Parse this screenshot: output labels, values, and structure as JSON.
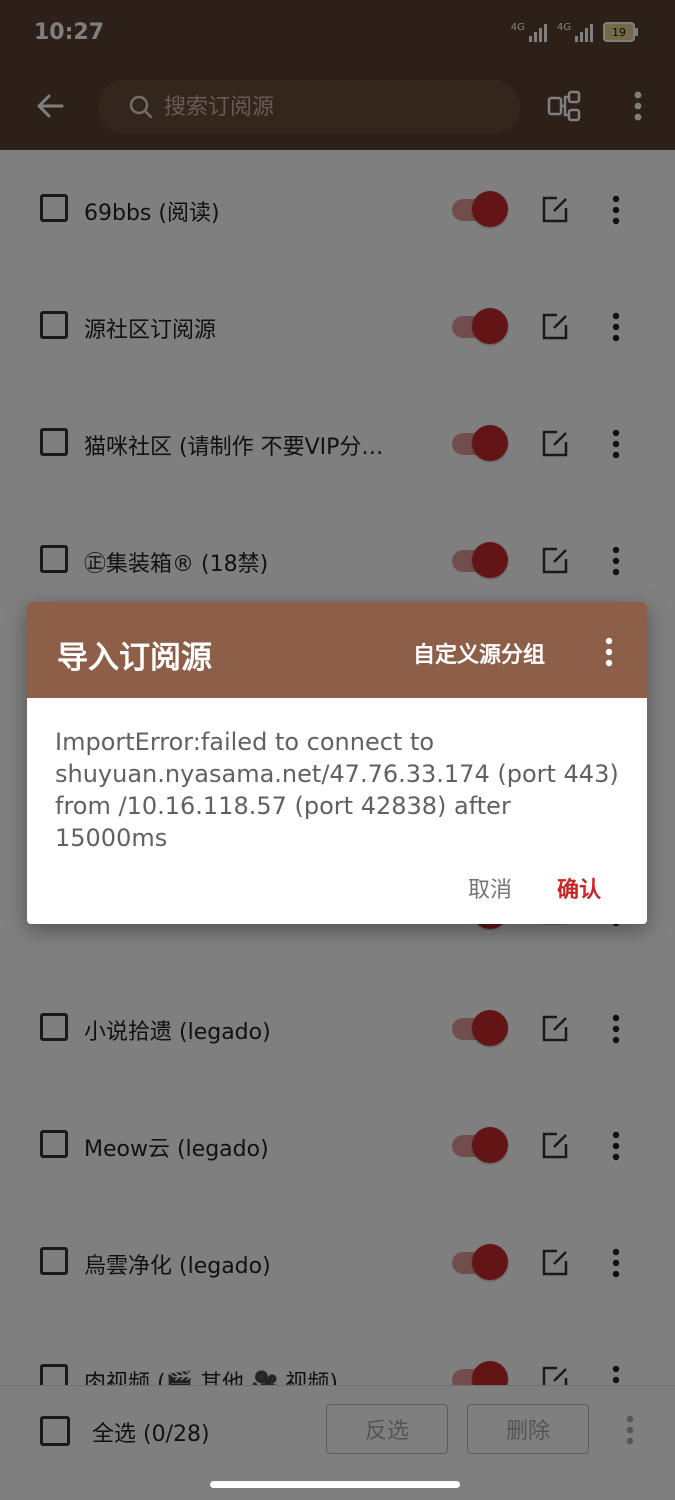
{
  "status_bar": {
    "time": "10:27",
    "signal1_label": "4G",
    "signal2_label": "4G",
    "battery": "19"
  },
  "app_bar": {
    "search_placeholder": "搜索订阅源",
    "back_icon": "arrow-left-icon",
    "group_icon": "group-icon",
    "more_icon": "more-vert-icon"
  },
  "list": {
    "items": [
      {
        "name": "69bbs (阅读)",
        "enabled": true
      },
      {
        "name": "源社区订阅源",
        "enabled": true
      },
      {
        "name": "猫咪社区 (请制作 不要VIP分…",
        "enabled": true
      },
      {
        "name": "㊣集装箱® (18禁)",
        "enabled": true
      },
      {
        "name": "",
        "enabled": true
      },
      {
        "name": "",
        "enabled": true
      },
      {
        "name": "",
        "enabled": true
      },
      {
        "name": "小说拾遗 (legado)",
        "enabled": true
      },
      {
        "name": "Meow云 (legado)",
        "enabled": true
      },
      {
        "name": "烏雲净化 (legado)",
        "enabled": true
      },
      {
        "name": "肉视频 (🎬 其他 🎥 视频)",
        "enabled": true
      }
    ]
  },
  "bottom_bar": {
    "select_all": "全选 (0/28)",
    "invert": "反选",
    "delete": "删除"
  },
  "dialog": {
    "title": "导入订阅源",
    "custom_group": "自定义源分组",
    "message": "ImportError:failed to connect to shuyuan.nyasama.net/47.76.33.174 (port 443) from /10.16.118.57 (port 42838) after 15000ms",
    "cancel": "取消",
    "confirm": "确认"
  },
  "colors": {
    "primary": "#5b4030",
    "dialog_header": "#8d5e48",
    "accent": "#c62828"
  }
}
